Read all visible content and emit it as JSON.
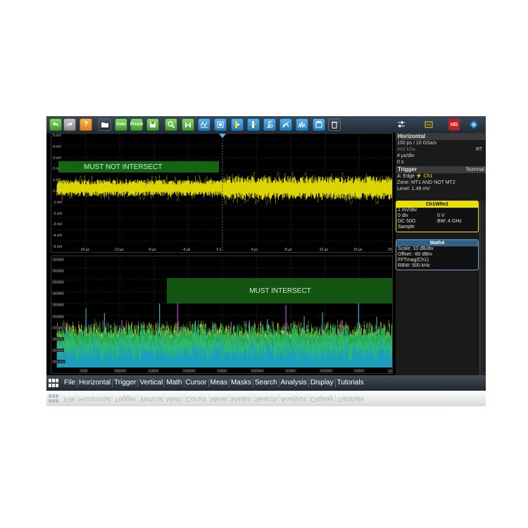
{
  "plot_top": {
    "y_labels": [
      "5 mV",
      "4 mV",
      "3 mV",
      "2 mV",
      "1 mV",
      "0 mV",
      "-1 mV",
      "-2 mV",
      "-3 mV",
      "-4 mV",
      "-5 mV"
    ],
    "x_labels": [
      "-16 µs",
      "-12 µs",
      "-8 µs",
      "-4 µs",
      "0 s",
      "4 µs",
      "8 µs",
      "12 µs",
      "16 µs",
      "20 µs"
    ],
    "mask_label": "MUST NOT INTERSECT"
  },
  "plot_bottom": {
    "y_labels": [
      "-10 dBm",
      "-20 dBm",
      "-30 dBm",
      "-40 dBm",
      "-50 dBm",
      "-60 dBm",
      "-70 dBm",
      "-80 dBm",
      "-90 dBm",
      "-100 dBm"
    ],
    "x_labels": [
      "0 Hz",
      "500 kHz",
      "1 MHz",
      "1.5 MHz",
      "2 MHz",
      "2.5 MHz",
      "3 MHz",
      "3.5 MHz",
      "4 MHz",
      "4.5 MHz"
    ],
    "mask_label": "MUST INTERSECT"
  },
  "toolbar": {
    "auto_label": "Auto",
    "preset_label": "Preset",
    "hd_label": "HD"
  },
  "horizontal": {
    "title": "Horizontal",
    "resolution": "100 ps / 10 GSa/s",
    "record": "400 kSa",
    "mode": "RT",
    "scale": "4 µs/div",
    "position": "0 s"
  },
  "trigger": {
    "title": "Trigger",
    "mode": "Normal",
    "source_line": "A:    Edge",
    "source_channel": "Ch1",
    "zone": "Zone: MT1 AND NOT MT2",
    "level": "Level: 1.49 mV"
  },
  "ch1": {
    "title": "Ch1Wfm1",
    "scale": "1 mV/div",
    "offset_div": "0 div",
    "offset_v": "0 V",
    "coupling": "DC 50Ω",
    "bandwidth": "BW: 4 GHz",
    "acq": "Sample"
  },
  "math4": {
    "title": "Math4",
    "scale": "Scale: 10 dB/div",
    "offset": "Offset: -80 dBm",
    "function": "FFTmag(Ch1)",
    "rbw": "RBW: 500 kHz"
  },
  "menu": [
    "File",
    "Horizontal",
    "Trigger",
    "Vertical",
    "Math",
    "Cursor",
    "Meas",
    "Masks",
    "Search",
    "Analysis",
    "Display",
    "Tutorials"
  ],
  "colors": {
    "ch1": "#e8e000",
    "spectrum_low": "#1fb0d0",
    "spectrum_mid": "#30c060",
    "spectrum_high": "#e0e020",
    "mask": "#148214",
    "toolbar_button": "#1f78b8"
  }
}
